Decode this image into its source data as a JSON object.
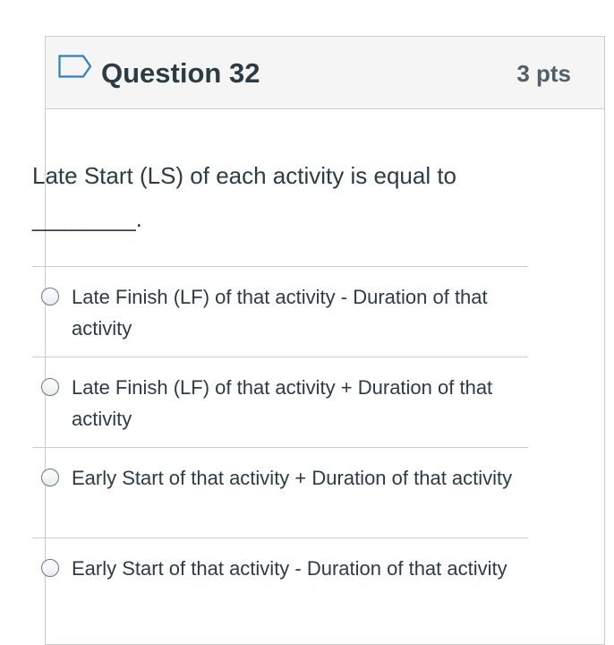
{
  "question": {
    "title": "Question 32",
    "points": "3 pts",
    "prompt": "Late Start (LS) of each activity is equal to ________.",
    "options": [
      {
        "label": "Late Finish (LF) of that activity - Duration of that activity"
      },
      {
        "label": "Late Finish (LF) of that activity + Duration of that activity"
      },
      {
        "label": "Early Start of that activity + Duration of that activity"
      },
      {
        "label": "Early Start of that activity - Duration of that activity"
      }
    ]
  },
  "icons": {
    "flag": "flag-outline-icon",
    "radio": "radio-button-icon"
  },
  "colors": {
    "text": "#2d3b45",
    "header_bg": "#f5f5f5",
    "border": "#c7cdd1",
    "flag": "#2d7fc7"
  }
}
